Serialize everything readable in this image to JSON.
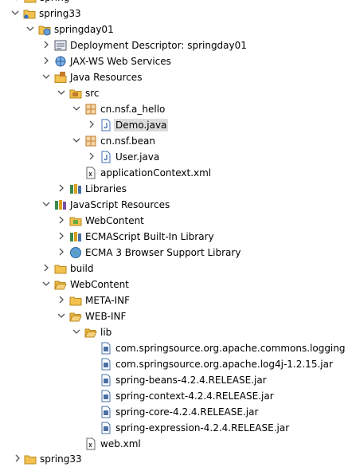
{
  "tree": {
    "partial_top_label": "spring",
    "items": [
      {
        "label": "spring33"
      },
      {
        "label": "springday01"
      },
      {
        "label": "Deployment Descriptor: springday01"
      },
      {
        "label": "JAX-WS Web Services"
      },
      {
        "label": "Java Resources"
      },
      {
        "label": "src"
      },
      {
        "label": "cn.nsf.a_hello"
      },
      {
        "label": "Demo.java"
      },
      {
        "label": "cn.nsf.bean"
      },
      {
        "label": "User.java"
      },
      {
        "label": "applicationContext.xml"
      },
      {
        "label": "Libraries"
      },
      {
        "label": "JavaScript Resources"
      },
      {
        "label": "WebContent"
      },
      {
        "label": "ECMAScript Built-In Library"
      },
      {
        "label": "ECMA 3 Browser Support Library"
      },
      {
        "label": "build"
      },
      {
        "label": "WebContent"
      },
      {
        "label": "META-INF"
      },
      {
        "label": "WEB-INF"
      },
      {
        "label": "lib"
      },
      {
        "label": "com.springsource.org.apache.commons.logging"
      },
      {
        "label": "com.springsource.org.apache.log4j-1.2.15.jar"
      },
      {
        "label": "spring-beans-4.2.4.RELEASE.jar"
      },
      {
        "label": "spring-context-4.2.4.RELEASE.jar"
      },
      {
        "label": "spring-core-4.2.4.RELEASE.jar"
      },
      {
        "label": "spring-expression-4.2.4.RELEASE.jar"
      },
      {
        "label": "web.xml"
      }
    ],
    "partial_bottom_label": "spring33"
  },
  "colors": {
    "selection": "#dcdcdc",
    "folder": "#f2c14e",
    "package": "#c47a2c",
    "java_file": "#3f6fb5",
    "jar": "#4a6fa5"
  }
}
